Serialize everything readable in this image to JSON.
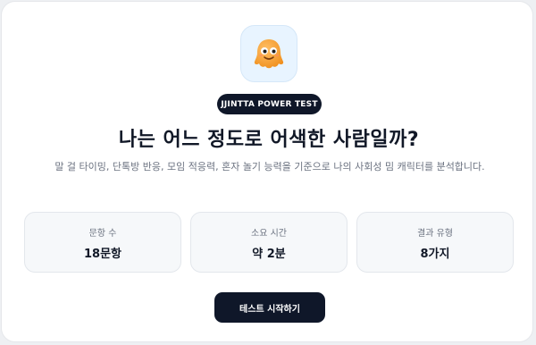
{
  "header": {
    "mascot_icon": "orange-blob-mascot-icon",
    "badge": "JJINTTA POWER TEST",
    "title": "나는 어느 정도로 어색한 사람일까?",
    "description": "말 걸 타이밍, 단톡방 반응, 모임 적응력, 혼자 놀기 능력을 기준으로 나의 사회성 밈 캐릭터를 분석합니다."
  },
  "stats": [
    {
      "label": "문항 수",
      "value": "18문항"
    },
    {
      "label": "소요 시간",
      "value": "약 2분"
    },
    {
      "label": "결과 유형",
      "value": "8가지"
    }
  ],
  "actions": {
    "start_label": "테스트 시작하기"
  },
  "colors": {
    "accent_dark": "#0f1729",
    "mascot_orange": "#f59e2d",
    "mascot_bg": "#e8f4ff"
  }
}
